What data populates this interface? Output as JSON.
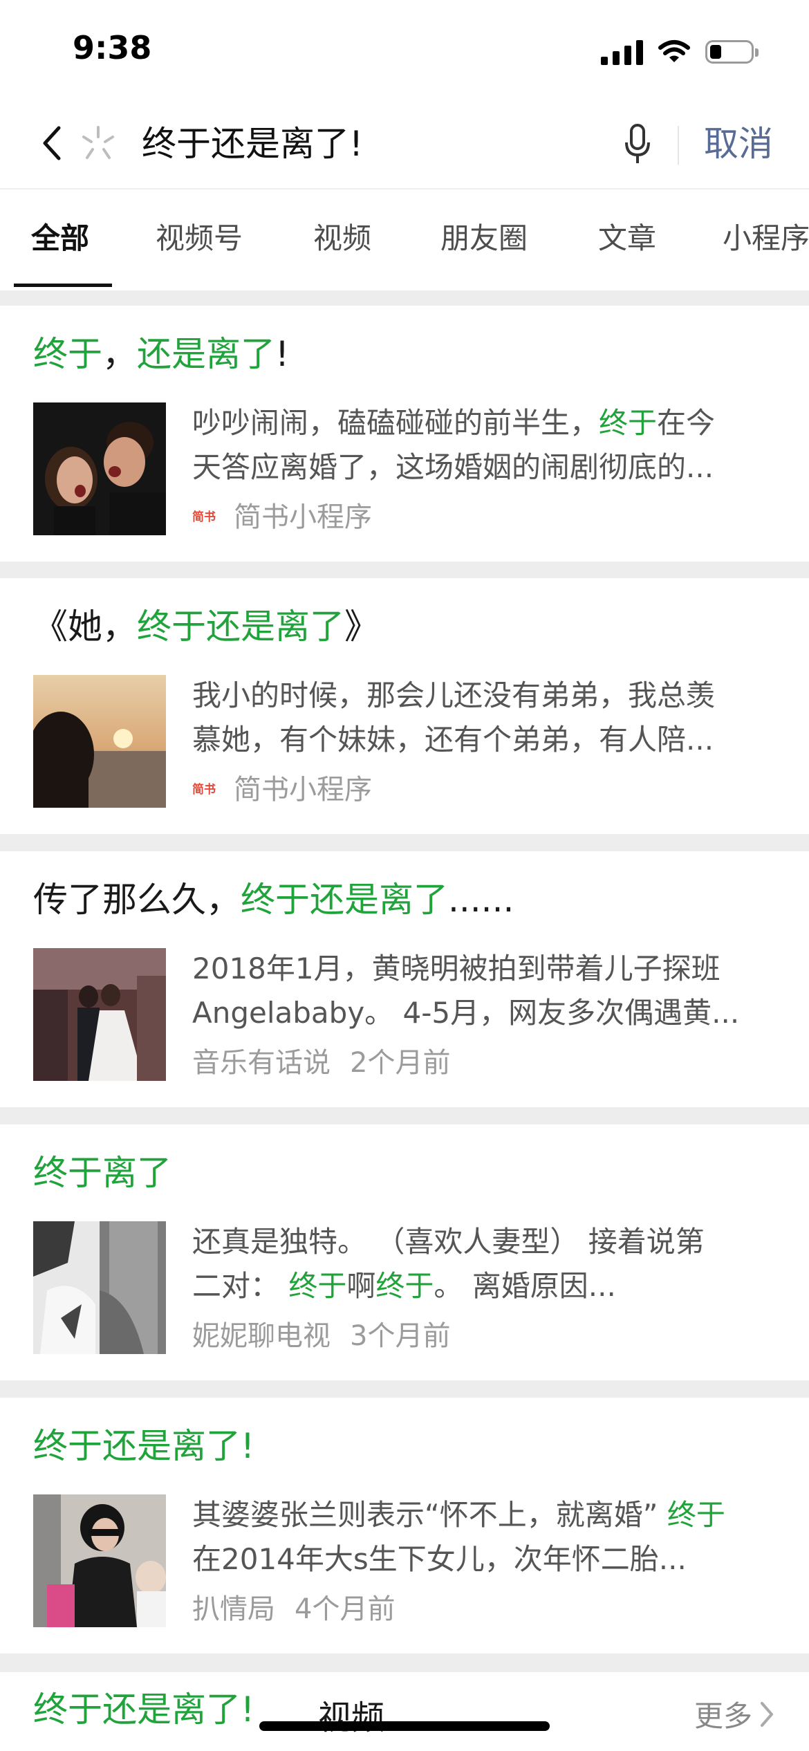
{
  "status_bar": {
    "time": "9:38"
  },
  "search": {
    "query": "终于还是离了!",
    "cancel_label": "取消"
  },
  "tabs": [
    {
      "label": "全部",
      "active": true
    },
    {
      "label": "视频号"
    },
    {
      "label": "视频"
    },
    {
      "label": "朋友圈"
    },
    {
      "label": "文章"
    },
    {
      "label": "小程序"
    }
  ],
  "results": [
    {
      "title_parts": [
        {
          "text": "终于",
          "hl": true
        },
        {
          "text": "，"
        },
        {
          "text": "还是离了",
          "hl": true
        },
        {
          "text": "!"
        }
      ],
      "desc_line1": [
        {
          "text": "吵吵闹闹，磕磕碰碰的前半生，"
        },
        {
          "text": "终于",
          "hl": true
        },
        {
          "text": "在今"
        }
      ],
      "desc_line2": "天答应离婚了，这场婚姻的闹剧彻底的...",
      "source_logo": "简书",
      "source": "简书小程序",
      "time": ""
    },
    {
      "title_parts": [
        {
          "text": "《她，"
        },
        {
          "text": "终于还是离了",
          "hl": true
        },
        {
          "text": "》"
        }
      ],
      "desc_line1": [
        {
          "text": "我小的时候，那会儿还没有弟弟，我总羡"
        }
      ],
      "desc_line2": "慕她，有个妹妹，还有个弟弟，有人陪...",
      "source_logo": "简书",
      "source": "简书小程序",
      "time": ""
    },
    {
      "title_parts": [
        {
          "text": "传了那么久，"
        },
        {
          "text": "终于还是离了",
          "hl": true
        },
        {
          "text": "......"
        }
      ],
      "desc_line1": [
        {
          "text": "2018年1月，黄晓明被拍到带着儿子探班"
        }
      ],
      "desc_line2": "Angelababy。 4-5月，网友多次偶遇黄...",
      "source_logo": "",
      "source": "音乐有话说",
      "time": "2个月前"
    },
    {
      "title_parts": [
        {
          "text": "终于离了",
          "hl": true
        }
      ],
      "desc_line1": [
        {
          "text": "还真是独特。 （喜欢人妻型） 接着说第"
        }
      ],
      "desc_line2_parts": [
        {
          "text": "二对： "
        },
        {
          "text": "终于",
          "hl": true
        },
        {
          "text": "啊"
        },
        {
          "text": "终于",
          "hl": true
        },
        {
          "text": "。 离婚原因..."
        }
      ],
      "source_logo": "",
      "source": "妮妮聊电视",
      "time": "3个月前"
    },
    {
      "title_parts": [
        {
          "text": "终于还是离了",
          "hl": true
        },
        {
          "text": "!"
        }
      ],
      "desc_line1": [
        {
          "text": "其婆婆张兰则表示“怀不上，就离婚” "
        },
        {
          "text": "终于",
          "hl": true
        }
      ],
      "desc_line2": "在2014年大s生下女儿，次年怀二胎...",
      "source_logo": "",
      "source": "扒情局",
      "time": "4个月前"
    }
  ],
  "video_section": {
    "title_parts": [
      {
        "text": "终于还是离了",
        "hl": true
      },
      {
        "text": "!"
      }
    ],
    "label": "视频",
    "more_label": "更多"
  }
}
